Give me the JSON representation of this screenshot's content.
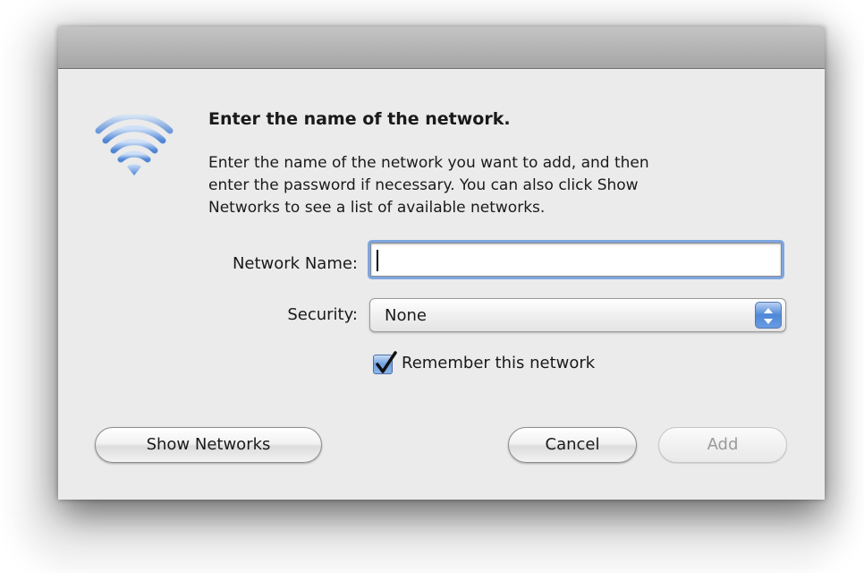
{
  "dialog": {
    "heading": "Enter the name of the network.",
    "description_lines": [
      "Enter the name of the network you want to add, and then",
      "enter the password if necessary. You can also click Show",
      "Networks to see a list of available networks."
    ],
    "network_name": {
      "label": "Network Name:",
      "value": ""
    },
    "security": {
      "label": "Security:",
      "selected": "None"
    },
    "remember": {
      "label": "Remember this network",
      "checked": true
    },
    "buttons": {
      "show_networks": "Show Networks",
      "cancel": "Cancel",
      "add": "Add"
    },
    "icon": "wifi-icon",
    "accent_color": "#5b8fdc"
  }
}
